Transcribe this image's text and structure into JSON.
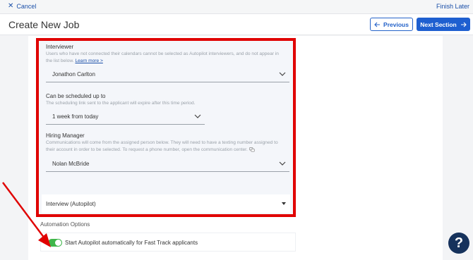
{
  "topbar": {
    "cancel_label": "Cancel",
    "finish_label": "Finish Later"
  },
  "header": {
    "title": "Create New Job",
    "previous_label": "Previous",
    "next_label": "Next Section"
  },
  "form": {
    "interviewer": {
      "label": "Interviewer",
      "help_1": "Users who have not connected their calendars cannot be selected as Autopilot interviewers, and do not appear in",
      "help_2": "the list below.",
      "learn_more": "Learn more >",
      "value": "Jonathon Carlton"
    },
    "schedule": {
      "label": "Can be scheduled up to",
      "help": "The scheduling link sent to the applicant will expire after this time period.",
      "value": "1 week from today"
    },
    "hiring_manager": {
      "label": "Hiring Manager",
      "help_1": "Communications will come from the assigned person below. They will need to have a texting number assigned to",
      "help_2": "their account in order to be selected. To request a phone number, open the communication center.",
      "value": "Nolan McBride"
    },
    "interview_type": {
      "value": "Interview (Autopilot)"
    }
  },
  "automation": {
    "heading": "Automation Options",
    "toggle_label": "Start Autopilot automatically for Fast Track applicants",
    "toggle_on": true
  },
  "help_button": {
    "label": "?"
  },
  "colors": {
    "accent": "#1e5fd0",
    "highlight": "#e00000",
    "toggle": "#3fb64a",
    "help": "#16325c"
  },
  "icons": [
    "close-icon",
    "arrow-left-icon",
    "arrow-right-icon",
    "chevron-down-icon",
    "chat-icon",
    "caret-down-icon",
    "help-icon"
  ]
}
